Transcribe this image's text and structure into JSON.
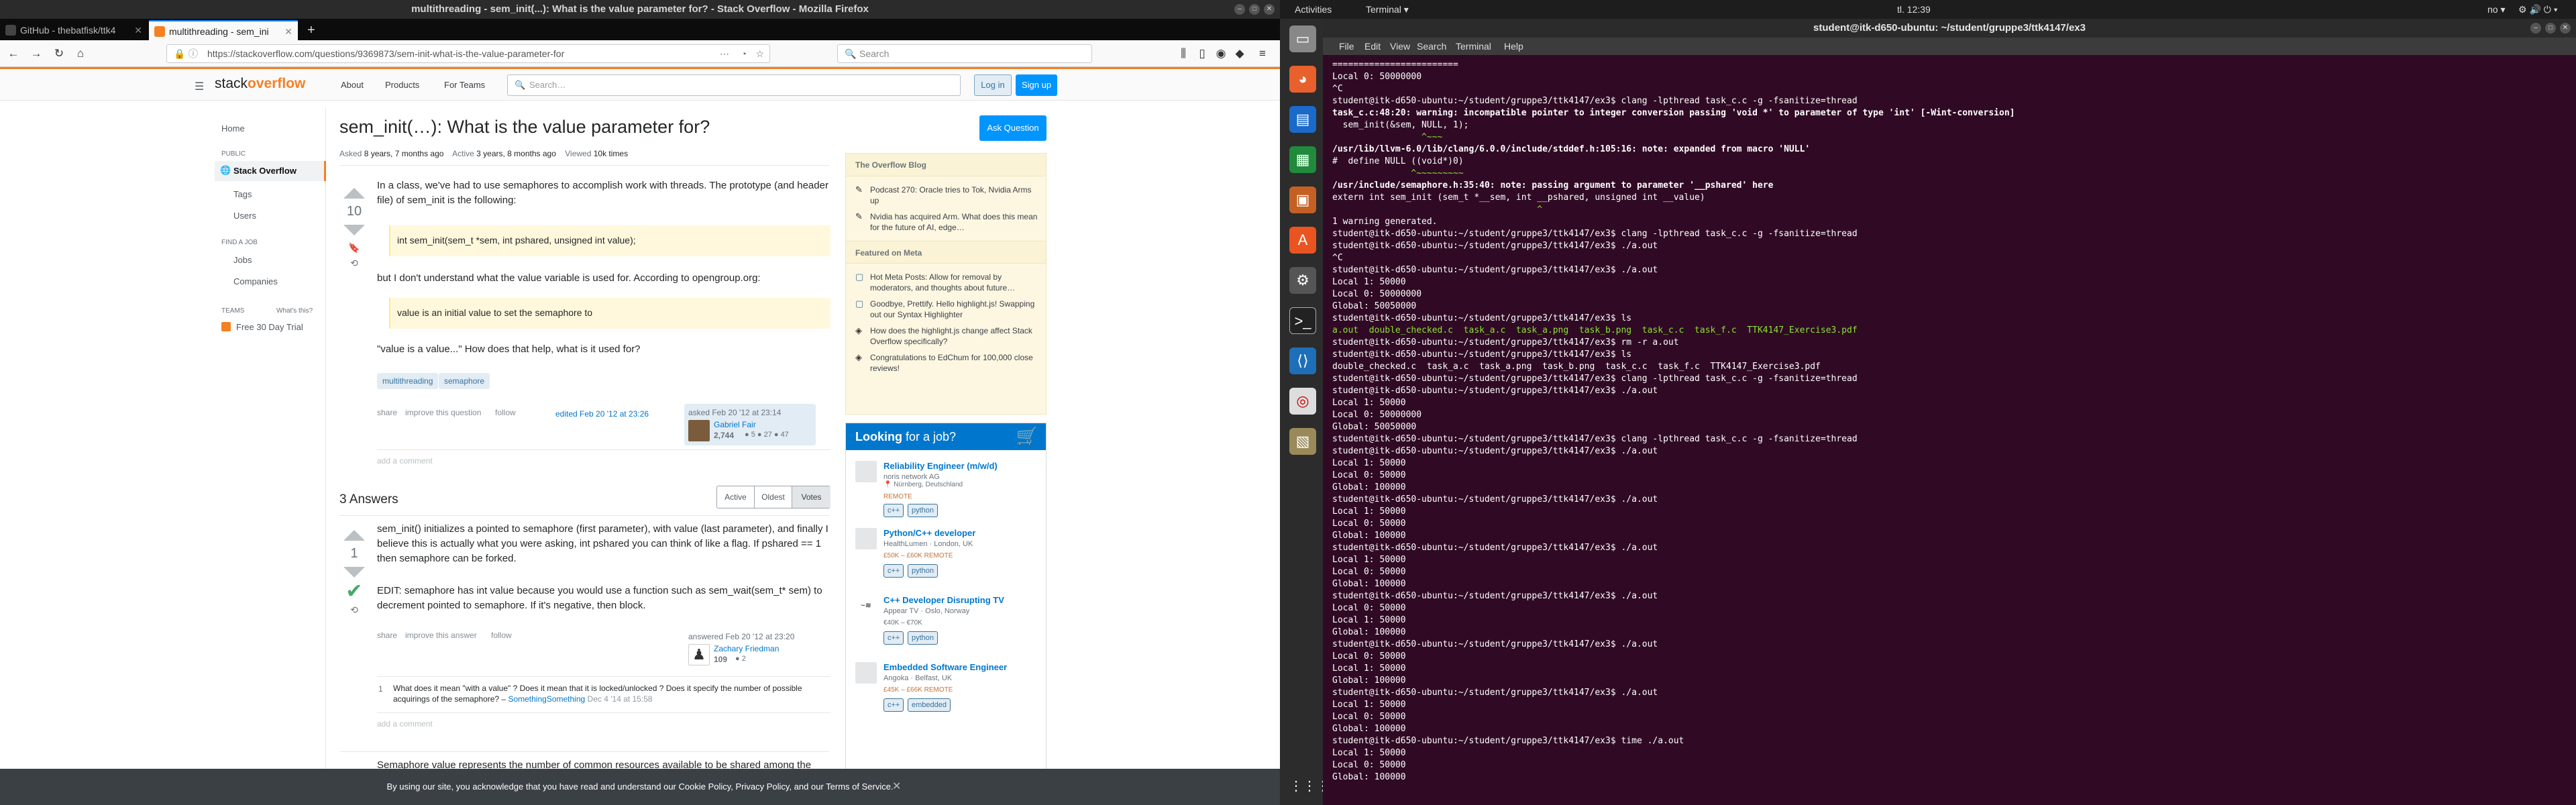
{
  "firefox": {
    "window_title": "multithreading - sem_init(...): What is the value parameter for? - Stack Overflow - Mozilla Firefox",
    "tabs": [
      {
        "label": "GitHub - thebatfisk/ttk4",
        "active": false
      },
      {
        "label": "multithreading - sem_ini",
        "active": true
      }
    ],
    "new_tab": "+",
    "url": "https://stackoverflow.com/questions/9369873/sem-init-what-is-the-value-parameter-for",
    "search_placeholder": "Search",
    "nav": {
      "back": "←",
      "forward": "→",
      "reload": "↻",
      "home": "⌂"
    }
  },
  "so": {
    "logo_a": "stack",
    "logo_b": "overflow",
    "top_links": [
      "About",
      "Products",
      "For Teams"
    ],
    "search_placeholder": "Search…",
    "login": "Log in",
    "signup": "Sign up",
    "left_nav": {
      "home": "Home",
      "public_header": "PUBLIC",
      "stack_overflow": "Stack Overflow",
      "tags": "Tags",
      "users": "Users",
      "find_job_header": "FIND A JOB",
      "jobs": "Jobs",
      "companies": "Companies",
      "teams_header": "TEAMS",
      "whats_this": "What's this?",
      "free_trial": "Free 30 Day Trial"
    },
    "question": {
      "title": "sem_init(…): What is the value parameter for?",
      "ask_button": "Ask Question",
      "meta_asked_label": "Asked",
      "meta_asked": "8 years, 7 months ago",
      "meta_active_label": "Active",
      "meta_active": "3 years, 8 months ago",
      "meta_viewed_label": "Viewed",
      "meta_viewed": "10k times",
      "votes": "10",
      "p1": "In a class, we've had to use semaphores to accomplish work with threads. The prototype (and header file) of sem_init is the following:",
      "code": "int sem_init(sem_t *sem, int pshared, unsigned int value);",
      "p2": "but I don't understand what the value variable is used for. According to opengroup.org:",
      "quote": "value is an initial value to set the semaphore to",
      "p3": "\"value is a value...\" How does that help, what is it used for?",
      "tags": [
        "multithreading",
        "semaphore"
      ],
      "share": "share",
      "improve": "improve this question",
      "follow": "follow",
      "edited": "edited Feb 20 '12 at 23:26",
      "asked_when": "asked Feb 20 '12 at 23:14",
      "asker": "Gabriel Fair",
      "asker_rep": "2,744",
      "asker_badges": "● 5  ● 27  ● 47",
      "add_comment": "add a comment"
    },
    "answers": {
      "count_label": "3 Answers",
      "sort": [
        "Active",
        "Oldest",
        "Votes"
      ],
      "a1": {
        "votes": "1",
        "p1": "sem_init() initializes a pointed to semaphore (first parameter), with value (last parameter), and finally I believe this is actually what you were asking, int pshared you can think of like a flag. If pshared == 1 then semaphore can be forked.",
        "p2": "EDIT: semaphore has int value because you would use a function such as sem_wait(sem_t* sem) to decrement pointed to semaphore. If it's negative, then block.",
        "share": "share",
        "improve": "improve this answer",
        "follow": "follow",
        "answered": "answered Feb 20 '12 at 23:20",
        "author": "Zachary Friedman",
        "rep": "109",
        "badges": "● 2",
        "comment_votes": "1",
        "comment": "What does it mean \"with a value\" ? Does it mean that it is locked/unlocked ? Does it specify the number of possible acquirings of the semaphore? –",
        "comment_author": "SomethingSomething",
        "comment_date": "Dec 4 '14 at 15:58",
        "add_comment": "add a comment"
      },
      "a2_start": "Semaphore value represents the number of common resources available to be shared among the"
    },
    "sidebar": {
      "blog_header": "The Overflow Blog",
      "blog_items": [
        "Podcast 270: Oracle tries to Tok, Nvidia Arms up",
        "Nvidia has acquired Arm. What does this mean for the future of AI, edge…"
      ],
      "meta_header": "Featured on Meta",
      "meta_items": [
        "Hot Meta Posts: Allow for removal by moderators, and thoughts about future…",
        "Goodbye, Prettify. Hello highlight.js! Swapping out our Syntax Highlighter",
        "How does the highlight.js change affect Stack Overflow specifically?",
        "Congratulations to EdChum for 100,000 close reviews!"
      ],
      "jobs_header_a": "Looking",
      "jobs_header_b": " for a job?",
      "jobs": [
        {
          "title": "Reliability Engineer (m/w/d)",
          "company": "noris network AG",
          "loc": "Nürnberg, Deutschland",
          "perks": "REMOTE",
          "tag": "python"
        },
        {
          "title": "Python/C++ developer",
          "company": "HealthLumen",
          "loc": "London, UK",
          "perks": "£50K – £60K  REMOTE",
          "tag": "python"
        },
        {
          "title": "C++ Developer Disrupting TV",
          "company": "Appear TV",
          "loc": "Oslo, Norway",
          "perks": "€40K – €70K",
          "tag": "python"
        },
        {
          "title": "Embedded Software Engineer",
          "company": "Angoka",
          "loc": "Belfast, UK",
          "perks": "£45K – £66K  REMOTE",
          "tag": "embedded"
        }
      ]
    },
    "cookie": "By using our site, you acknowledge that you have read and understand our Cookie Policy, Privacy Policy, and our Terms of Service.",
    "cookie_close": "✕"
  },
  "gnome": {
    "activities": "Activities",
    "app": "Terminal ▾",
    "clock": "tl. 12:39",
    "lang": "no ▾",
    "status_icons": "⚙ 🔊 ⏻ ▾"
  },
  "terminal": {
    "title": "student@itk-d650-ubuntu: ~/student/gruppe3/ttk4147/ex3",
    "menu": [
      "File",
      "Edit",
      "View",
      "Search",
      "Terminal",
      "Help"
    ],
    "lines": [
      {
        "cls": "",
        "text": "========================"
      },
      {
        "cls": "",
        "text": "Local 0: 50000000"
      },
      {
        "cls": "",
        "text": "^C"
      },
      {
        "cls": "t-prompt",
        "text": "student@itk-d650-ubuntu:~/student/gruppe3/ttk4147/ex3$ clang -lpthread task_c.c -g -fsanitize=thread"
      },
      {
        "cls": "t-bold",
        "text": "task_c.c:48:20: warning: incompatible pointer to integer conversion passing 'void *' to parameter of type 'int' [-Wint-conversion]"
      },
      {
        "cls": "",
        "text": "  sem_init(&sem, NULL, 1);"
      },
      {
        "cls": "t-green",
        "text": "                 ^~~~"
      },
      {
        "cls": "t-bold",
        "text": "/usr/lib/llvm-6.0/lib/clang/6.0.0/include/stddef.h:105:16: note: expanded from macro 'NULL'"
      },
      {
        "cls": "",
        "text": "#  define NULL ((void*)0)"
      },
      {
        "cls": "t-green",
        "text": "               ^~~~~~~~~~"
      },
      {
        "cls": "t-bold",
        "text": "/usr/include/semaphore.h:35:40: note: passing argument to parameter '__pshared' here"
      },
      {
        "cls": "",
        "text": "extern int sem_init (sem_t *__sem, int __pshared, unsigned int __value)"
      },
      {
        "cls": "t-green",
        "text": "                                       ^"
      },
      {
        "cls": "",
        "text": "1 warning generated."
      },
      {
        "cls": "t-prompt",
        "text": "student@itk-d650-ubuntu:~/student/gruppe3/ttk4147/ex3$ clang -lpthread task_c.c -g -fsanitize=thread"
      },
      {
        "cls": "t-prompt",
        "text": "student@itk-d650-ubuntu:~/student/gruppe3/ttk4147/ex3$ ./a.out"
      },
      {
        "cls": "",
        "text": "^C"
      },
      {
        "cls": "t-prompt",
        "text": "student@itk-d650-ubuntu:~/student/gruppe3/ttk4147/ex3$ ./a.out"
      },
      {
        "cls": "",
        "text": "Local 1: 50000"
      },
      {
        "cls": "",
        "text": "Local 0: 50000000"
      },
      {
        "cls": "",
        "text": "Global: 50050000"
      },
      {
        "cls": "t-prompt",
        "text": "student@itk-d650-ubuntu:~/student/gruppe3/ttk4147/ex3$ ls"
      },
      {
        "cls": "t-green",
        "text": "a.out  double_checked.c  task_a.c  task_a.png  task_b.png  task_c.c  task_f.c  TTK4147_Exercise3.pdf"
      },
      {
        "cls": "t-prompt",
        "text": "student@itk-d650-ubuntu:~/student/gruppe3/ttk4147/ex3$ rm -r a.out"
      },
      {
        "cls": "t-prompt",
        "text": "student@itk-d650-ubuntu:~/student/gruppe3/ttk4147/ex3$ ls"
      },
      {
        "cls": "",
        "text": "double_checked.c  task_a.c  task_a.png  task_b.png  task_c.c  task_f.c  TTK4147_Exercise3.pdf"
      },
      {
        "cls": "t-prompt",
        "text": "student@itk-d650-ubuntu:~/student/gruppe3/ttk4147/ex3$ clang -lpthread task_c.c -g -fsanitize=thread"
      },
      {
        "cls": "t-prompt",
        "text": "student@itk-d650-ubuntu:~/student/gruppe3/ttk4147/ex3$ ./a.out"
      },
      {
        "cls": "",
        "text": "Local 1: 50000"
      },
      {
        "cls": "",
        "text": "Local 0: 50000000"
      },
      {
        "cls": "",
        "text": "Global: 50050000"
      },
      {
        "cls": "t-prompt",
        "text": "student@itk-d650-ubuntu:~/student/gruppe3/ttk4147/ex3$ clang -lpthread task_c.c -g -fsanitize=thread"
      },
      {
        "cls": "t-prompt",
        "text": "student@itk-d650-ubuntu:~/student/gruppe3/ttk4147/ex3$ ./a.out"
      },
      {
        "cls": "",
        "text": "Local 1: 50000"
      },
      {
        "cls": "",
        "text": "Local 0: 50000"
      },
      {
        "cls": "",
        "text": "Global: 100000"
      },
      {
        "cls": "t-prompt",
        "text": "student@itk-d650-ubuntu:~/student/gruppe3/ttk4147/ex3$ ./a.out"
      },
      {
        "cls": "",
        "text": "Local 1: 50000"
      },
      {
        "cls": "",
        "text": "Local 0: 50000"
      },
      {
        "cls": "",
        "text": "Global: 100000"
      },
      {
        "cls": "t-prompt",
        "text": "student@itk-d650-ubuntu:~/student/gruppe3/ttk4147/ex3$ ./a.out"
      },
      {
        "cls": "",
        "text": "Local 1: 50000"
      },
      {
        "cls": "",
        "text": "Local 0: 50000"
      },
      {
        "cls": "",
        "text": "Global: 100000"
      },
      {
        "cls": "t-prompt",
        "text": "student@itk-d650-ubuntu:~/student/gruppe3/ttk4147/ex3$ ./a.out"
      },
      {
        "cls": "",
        "text": "Local 0: 50000"
      },
      {
        "cls": "",
        "text": "Local 1: 50000"
      },
      {
        "cls": "",
        "text": "Global: 100000"
      },
      {
        "cls": "t-prompt",
        "text": "student@itk-d650-ubuntu:~/student/gruppe3/ttk4147/ex3$ ./a.out"
      },
      {
        "cls": "",
        "text": "Local 0: 50000"
      },
      {
        "cls": "",
        "text": "Local 1: 50000"
      },
      {
        "cls": "",
        "text": "Global: 100000"
      },
      {
        "cls": "t-prompt",
        "text": "student@itk-d650-ubuntu:~/student/gruppe3/ttk4147/ex3$ ./a.out"
      },
      {
        "cls": "",
        "text": "Local 1: 50000"
      },
      {
        "cls": "",
        "text": "Local 0: 50000"
      },
      {
        "cls": "",
        "text": "Global: 100000"
      },
      {
        "cls": "t-prompt",
        "text": "student@itk-d650-ubuntu:~/student/gruppe3/ttk4147/ex3$ time ./a.out"
      },
      {
        "cls": "",
        "text": "Local 1: 50000"
      },
      {
        "cls": "",
        "text": "Local 0: 50000"
      },
      {
        "cls": "",
        "text": "Global: 100000"
      }
    ]
  }
}
